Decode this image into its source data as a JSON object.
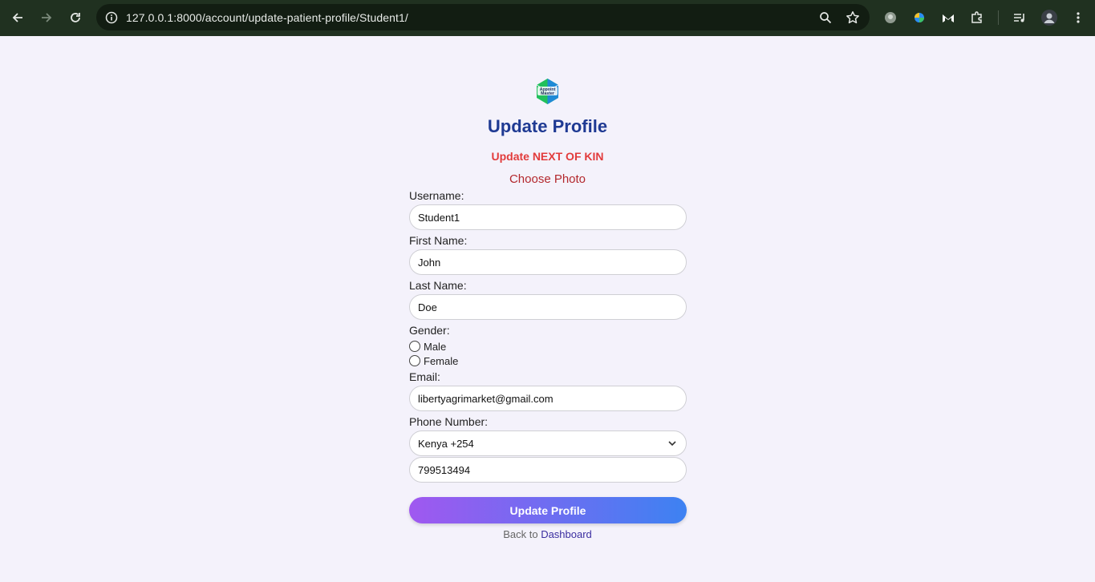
{
  "browser": {
    "url": "127.0.0.1:8000/account/update-patient-profile/Student1/"
  },
  "page": {
    "logo_text": "Appoint Master",
    "title": "Update Profile",
    "next_of_kin_link": "Update NEXT OF KIN",
    "choose_photo": "Choose Photo",
    "form": {
      "username_label": "Username:",
      "username_value": "Student1",
      "first_name_label": "First Name:",
      "first_name_value": "John",
      "last_name_label": "Last Name:",
      "last_name_value": "Doe",
      "gender_label": "Gender:",
      "gender_options": [
        "Male",
        "Female"
      ],
      "email_label": "Email:",
      "email_value": "libertyagrimarket@gmail.com",
      "phone_label": "Phone Number:",
      "country_code_value": "Kenya +254",
      "phone_value": "799513494",
      "submit_label": "Update Profile"
    },
    "footer": {
      "back_text": "Back to",
      "dashboard_link": "Dashboard"
    }
  },
  "colors": {
    "title": "#1f3a93",
    "next_of_kin": "#e23b3b",
    "choose_photo": "#b3282d",
    "button_gradient_start": "#a058f0",
    "button_gradient_end": "#3d82f2",
    "background": "#f4f2fb"
  }
}
